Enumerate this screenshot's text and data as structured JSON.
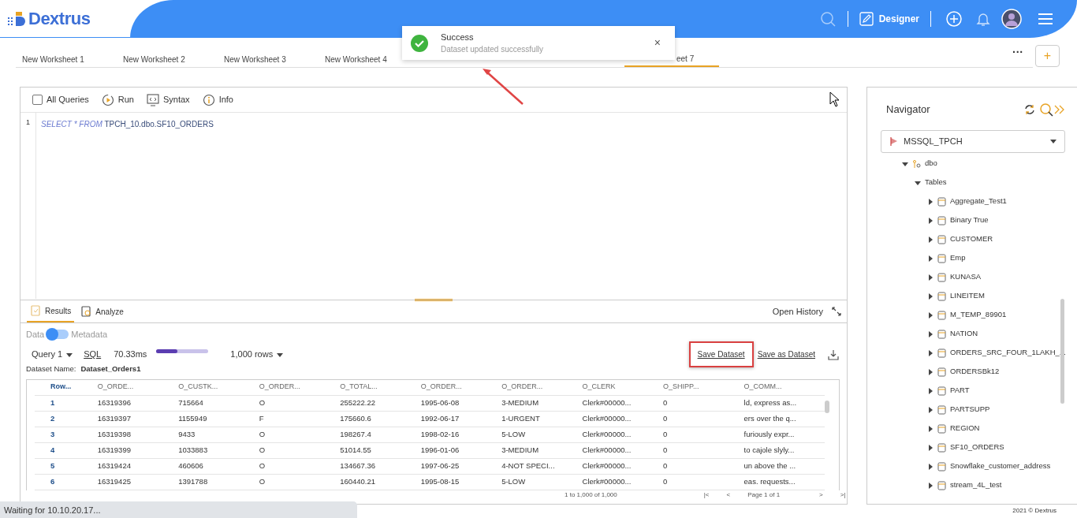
{
  "header": {
    "logo": "Dextrus",
    "mode": "Designer"
  },
  "toast": {
    "title": "Success",
    "message": "Dataset updated successfully",
    "close": "×"
  },
  "worksheet_tabs": [
    {
      "label": "New Worksheet 1",
      "selected": false
    },
    {
      "label": "New Worksheet 2",
      "selected": false
    },
    {
      "label": "New Worksheet 3",
      "selected": false
    },
    {
      "label": "New Worksheet 4",
      "selected": false
    },
    {
      "label": "eet 7",
      "selected": true
    }
  ],
  "tab_actions": {
    "more": "···",
    "add": "+"
  },
  "editor": {
    "toolbar": [
      {
        "kind": "checkbox",
        "label": "All Queries",
        "checked": false
      },
      {
        "kind": "run",
        "label": "Run"
      },
      {
        "kind": "syntax",
        "label": "Syntax"
      },
      {
        "kind": "info",
        "label": "Info"
      }
    ],
    "lines": [
      {
        "number": "1",
        "tokens": [
          {
            "kind": "keyword",
            "text": "SELECT * FROM"
          },
          {
            "kind": "ident",
            "text": "TPCH_10.dbo.SF10_ORDERS"
          }
        ]
      }
    ]
  },
  "results": {
    "tabs": [
      {
        "label": "Results",
        "selected": true
      },
      {
        "label": "Analyze",
        "selected": false
      }
    ],
    "open_history": "Open History",
    "toggle": {
      "left": "Data",
      "right": "Metadata",
      "on": false
    },
    "query": "Query 1",
    "sql": "SQL",
    "time": "70.33ms",
    "progress": {
      "level": 0.4
    },
    "rows": "1,000 rows",
    "save": "Save Dataset",
    "save_as": "Save as Dataset",
    "dataset_label": "Dataset Name:",
    "dataset_name": "Dataset_Orders1",
    "table": {
      "columns": [
        "Row...",
        "O_ORDE...",
        "O_CUSTK...",
        "O_ORDER...",
        "O_TOTAL...",
        "O_ORDER...",
        "O_ORDER...",
        "O_CLERK",
        "O_SHIPP...",
        "O_COMM..."
      ],
      "rows": [
        [
          "1",
          "16319396",
          "715664",
          "O",
          "255222.22",
          "1995-06-08",
          "3-MEDIUM",
          "Clerk#00000...",
          "0",
          "ld, express as..."
        ],
        [
          "2",
          "16319397",
          "1155949",
          "F",
          "175660.6",
          "1992-06-17",
          "1-URGENT",
          "Clerk#00000...",
          "0",
          "ers over the q..."
        ],
        [
          "3",
          "16319398",
          "9433",
          "O",
          "198267.4",
          "1998-02-16",
          "5-LOW",
          "Clerk#00000...",
          "0",
          "furiously expr..."
        ],
        [
          "4",
          "16319399",
          "1033883",
          "O",
          "51014.55",
          "1996-01-06",
          "3-MEDIUM",
          "Clerk#00000...",
          "0",
          "to cajole slyly..."
        ],
        [
          "5",
          "16319424",
          "460606",
          "O",
          "134667.36",
          "1997-06-25",
          "4-NOT SPECI...",
          "Clerk#00000...",
          "0",
          "un above the ..."
        ],
        [
          "6",
          "16319425",
          "1391788",
          "O",
          "160440.21",
          "1995-08-15",
          "5-LOW",
          "Clerk#00000...",
          "0",
          "eas. requests..."
        ]
      ]
    },
    "pagination": {
      "range": "1 to 1,000 of 1,000",
      "first": "|<",
      "prev": "<",
      "page_label": "Page",
      "page": "1",
      "of": "of",
      "pages": "1",
      "next": ">",
      "last": ">|"
    }
  },
  "navigator": {
    "title": "Navigator",
    "source": "MSSQL_TPCH",
    "tree": [
      {
        "label": "dbo",
        "kind": "schema",
        "expanded": true,
        "children": [
          {
            "label": "Tables",
            "expanded": true,
            "children": [
              {
                "label": "Aggregate_Test1",
                "kind": "table",
                "expanded": false
              },
              {
                "label": "Binary True",
                "kind": "table",
                "expanded": false
              },
              {
                "label": "CUSTOMER",
                "kind": "table",
                "expanded": false
              },
              {
                "label": "Emp",
                "kind": "table",
                "expanded": false
              },
              {
                "label": "KUNASA",
                "kind": "table",
                "expanded": false
              },
              {
                "label": "LINEITEM",
                "kind": "table",
                "expanded": false
              },
              {
                "label": "M_TEMP_89901",
                "kind": "table",
                "expanded": false
              },
              {
                "label": "NATION",
                "kind": "table",
                "expanded": false
              },
              {
                "label": "ORDERS_SRC_FOUR_1LAKH_...",
                "kind": "table",
                "expanded": false
              },
              {
                "label": "ORDERSBk12",
                "kind": "table",
                "expanded": false
              },
              {
                "label": "PART",
                "kind": "table",
                "expanded": false
              },
              {
                "label": "PARTSUPP",
                "kind": "table",
                "expanded": false
              },
              {
                "label": "REGION",
                "kind": "table",
                "expanded": false
              },
              {
                "label": "SF10_ORDERS",
                "kind": "table",
                "expanded": false
              },
              {
                "label": "Snowflake_customer_address",
                "kind": "table",
                "expanded": false
              },
              {
                "label": "stream_4L_test",
                "kind": "table",
                "expanded": false
              }
            ]
          }
        ]
      }
    ]
  },
  "annotations": {
    "arrow_to_toast": true,
    "highlight_save_dataset": true
  },
  "status_bar": {
    "text": "Waiting for 10.10.20.17..."
  },
  "footer": {
    "copyright": "2021 © Dextrus"
  }
}
